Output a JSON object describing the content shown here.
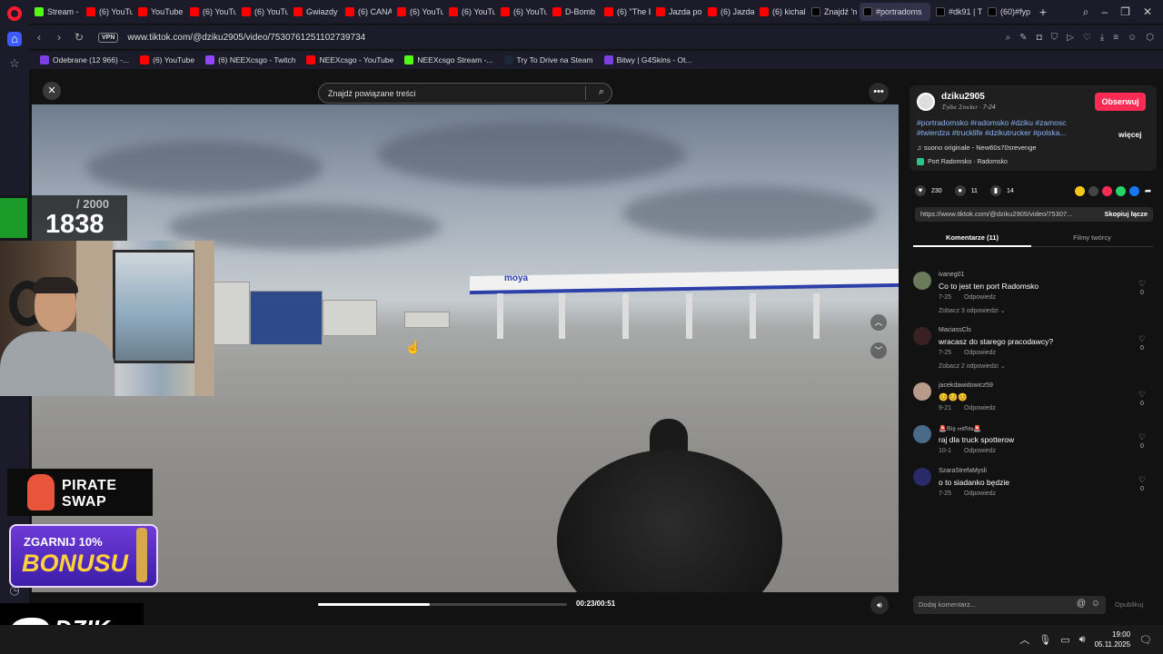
{
  "browser": {
    "tabs": [
      {
        "label": "Stream -",
        "icon": "kick"
      },
      {
        "label": "(6) YouTu",
        "icon": "yt"
      },
      {
        "label": "YouTube",
        "icon": "yt"
      },
      {
        "label": "(6) YouTu",
        "icon": "yt"
      },
      {
        "label": "(6) YouTu",
        "icon": "yt"
      },
      {
        "label": "Gwiazdy",
        "icon": "yt"
      },
      {
        "label": "(6) CANA",
        "icon": "yt"
      },
      {
        "label": "(6) YouTu",
        "icon": "yt"
      },
      {
        "label": "(6) YouTu",
        "icon": "yt"
      },
      {
        "label": "(6) YouTu",
        "icon": "yt"
      },
      {
        "label": "D-Bomb",
        "icon": "yt"
      },
      {
        "label": "(6) \"The E",
        "icon": "yt"
      },
      {
        "label": "Jazda po",
        "icon": "yt"
      },
      {
        "label": "(6) Jazda",
        "icon": "yt"
      },
      {
        "label": "(6) kichal",
        "icon": "yt"
      },
      {
        "label": "Znajdź 'n",
        "icon": "tt"
      },
      {
        "label": "#portradoms",
        "icon": "tt"
      },
      {
        "label": "#dk91 | T",
        "icon": "tt"
      },
      {
        "label": "(60)#fyp",
        "icon": "tt"
      }
    ],
    "url": "www.tiktok.com/@dziku2905/video/7530761251102739734",
    "vpn_label": "VPN",
    "bookmarks": [
      {
        "label": "Odebrane (12 966) -...",
        "icon": "g4"
      },
      {
        "label": "(6) YouTube",
        "icon": "yt"
      },
      {
        "label": "(6) NEEXcsgo - Twitch",
        "icon": "tw"
      },
      {
        "label": "NEEXcsgo - YouTube",
        "icon": "yt"
      },
      {
        "label": "NEEXcsgo Stream -...",
        "icon": "kick"
      },
      {
        "label": "Try To Drive na Steam",
        "icon": "steam"
      },
      {
        "label": "Bitwy | G4Skins - Ot...",
        "icon": "g4"
      }
    ]
  },
  "tiktok": {
    "search_placeholder": "Znajdź powiązane treści",
    "video": {
      "current_time": "00:23/00:51",
      "progress_fraction": 0.45,
      "station_brand": "moya"
    },
    "author": {
      "username": "dziku2905",
      "nickname_date": "𝔇𝔷𝔦𝔨𝔲 𝔗𝔯𝔲𝔠𝔨𝔢𝔯 · 7-24",
      "follow_label": "Obserwuj",
      "hashtags": "#portradomsko #radomsko #dziku #zamosc #twierdza #trucklife #dzikutrucker #polska...",
      "more_label": "więcej",
      "sound": "suono originale - New60s70srevenge",
      "location": "Port Radomsko · Radomsko"
    },
    "stats": {
      "likes": "230",
      "comments": "11",
      "saves": "14"
    },
    "share_link": "https://www.tiktok.com/@dziku2905/video/75307...",
    "copy_label": "Skopiuj łącze",
    "tab_comments": "Komentarze (11)",
    "tab_creator": "Filmy twórcy",
    "comments": [
      {
        "user": "ivaneg01",
        "text": "Co to jest ten port Radomsko",
        "date": "7-25",
        "reply": "Odpowiedz",
        "replies": "Zobacz 3 odpowiedzi ⌄",
        "likes": "0"
      },
      {
        "user": "MaciassCls",
        "text": "wracasz do starego pracodawcy?",
        "date": "7-25",
        "reply": "Odpowiedz",
        "replies": "Zobacz 2 odpowiedzi ⌄",
        "likes": "0"
      },
      {
        "user": "jacekdawidowicz59",
        "text": "😊😊😊",
        "date": "9-21",
        "reply": "Odpowiedz",
        "replies": "",
        "likes": "0"
      },
      {
        "user": "🚨𝔊𝔦𝔤 𝔪𝔞𝔣𝔦𝔞𝔰🚨",
        "text": "raj dla truck spotterow",
        "date": "10-1",
        "reply": "Odpowiedz",
        "replies": "",
        "likes": "0"
      },
      {
        "user": "SzaraStrefaMysli",
        "text": "o to siadanko będzie",
        "date": "7-25",
        "reply": "Odpowiedz",
        "replies": "",
        "likes": "0"
      }
    ],
    "add_comment_placeholder": "Dodaj komentarz...",
    "publish_label": "Opublikuj"
  },
  "overlay": {
    "goal": "/ 2000",
    "count": "1838",
    "pirate_line1": "PIRATE",
    "pirate_line2": "SWAP",
    "bonus_line1": "ZGARNIJ 10%",
    "bonus_line2": "BONUSU",
    "dzik": "DZIK."
  },
  "taskbar": {
    "time": "19:00",
    "date": "05.11.2025"
  },
  "colors": {
    "follow": "#fe2c55",
    "link": "#8ab4f8",
    "opera": "#ff1b2d"
  }
}
